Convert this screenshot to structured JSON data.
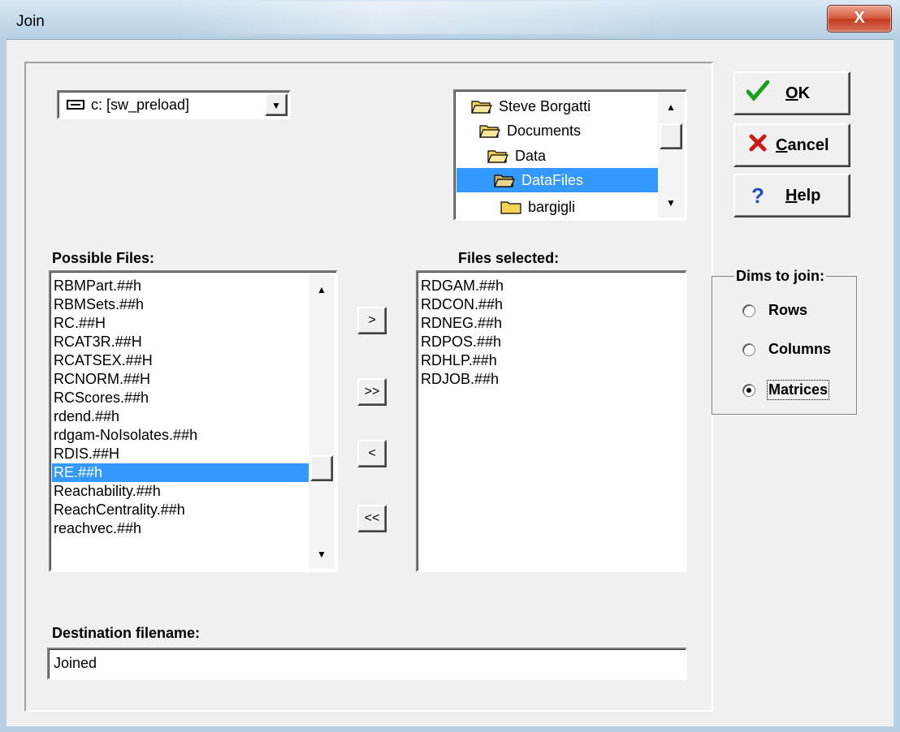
{
  "window": {
    "title": "Join",
    "close_glyph": "X"
  },
  "drive_combo": {
    "value": "c: [sw_preload]",
    "icon": "drive-icon",
    "arrow": "▼"
  },
  "folder_tree": {
    "items": [
      {
        "label": "Steve Borgatti"
      },
      {
        "label": "Documents"
      },
      {
        "label": "Data"
      },
      {
        "label": "DataFiles",
        "selected": true
      },
      {
        "label": "bargigli"
      }
    ],
    "up_arrow": "▲",
    "down_arrow": "▼"
  },
  "possible_files": {
    "label": "Possible Files:",
    "items": [
      "RBMPart.##h",
      "RBMSets.##h",
      "RC.##H",
      "RCAT3R.##H",
      "RCATSEX.##H",
      "RCNORM.##H",
      "RCScores.##h",
      "rdend.##h",
      "rdgam-NoIsolates.##h",
      "RDIS.##H",
      "RE.##h",
      "Reachability.##h",
      "ReachCentrality.##h",
      "reachvec.##h"
    ],
    "selected_index": 10,
    "up_arrow": "▲",
    "down_arrow": "▼"
  },
  "files_selected": {
    "label": "Files selected:",
    "items": [
      "RDGAM.##h",
      "RDCON.##h",
      "RDNEG.##h",
      "RDPOS.##h",
      "RDHLP.##h",
      "RDJOB.##h"
    ]
  },
  "move_buttons": {
    "add": ">",
    "add_all": ">>",
    "remove": "<",
    "remove_all": "<<"
  },
  "actions": {
    "ok": "OK",
    "cancel": "Cancel",
    "help": "Help"
  },
  "dims_group": {
    "title": "Dims to join:",
    "options": [
      {
        "label": "Rows",
        "checked": false
      },
      {
        "label": "Columns",
        "checked": false
      },
      {
        "label": "Matrices",
        "checked": true
      }
    ]
  },
  "destination": {
    "label": "Destination filename:",
    "value": "Joined"
  },
  "colors": {
    "selection": "#3399ff",
    "ok_check": "#1aa01a",
    "cancel_x": "#d01a1a",
    "help_q": "#1a4ad0",
    "folder": "#f5d258"
  }
}
